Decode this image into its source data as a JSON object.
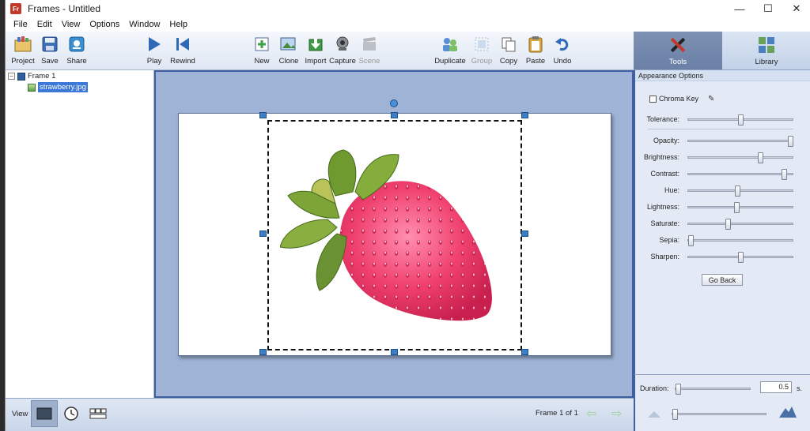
{
  "window": {
    "title": "Frames - Untitled",
    "app_icon_text": "Fr",
    "controls": {
      "minimize": "—",
      "maximize": "☐",
      "close": "✕"
    }
  },
  "menu": [
    "File",
    "Edit",
    "View",
    "Options",
    "Window",
    "Help"
  ],
  "toolbar": {
    "project": "Project",
    "save": "Save",
    "share": "Share",
    "play": "Play",
    "rewind": "Rewind",
    "new": "New",
    "clone": "Clone",
    "import": "Import",
    "capture": "Capture",
    "scene": "Scene",
    "duplicate": "Duplicate",
    "group": "Group",
    "copy": "Copy",
    "paste": "Paste",
    "undo": "Undo"
  },
  "right_tabs": {
    "tools": "Tools",
    "library": "Library"
  },
  "tree": {
    "frame": "Frame 1",
    "image": "strawberry.jpg"
  },
  "panel": {
    "header": "Appearance Options",
    "chroma_key": "Chroma Key",
    "sliders": [
      {
        "label": "Tolerance:",
        "value": 0.5
      },
      {
        "label": "Opacity:",
        "value": 1.0
      },
      {
        "label": "Brightness:",
        "value": 0.7
      },
      {
        "label": "Contrast:",
        "value": 0.94
      },
      {
        "label": "Hue:",
        "value": 0.47
      },
      {
        "label": "Lightness:",
        "value": 0.46
      },
      {
        "label": "Saturate:",
        "value": 0.37
      },
      {
        "label": "Sepia:",
        "value": 0.0
      },
      {
        "label": "Sharpen:",
        "value": 0.5
      }
    ],
    "go_back": "Go Back"
  },
  "bottom": {
    "view_label": "View",
    "frame_count": "Frame 1 of 1",
    "duration_label": "Duration:",
    "duration_value": "0.5",
    "duration_unit": "s.",
    "duration_slider": 0.0,
    "zoom_slider": 0.0
  },
  "colors": {
    "accent": "#3e5fa0",
    "canvas_bg": "#9fb3d6",
    "selection_bg": "#3b78d8"
  }
}
